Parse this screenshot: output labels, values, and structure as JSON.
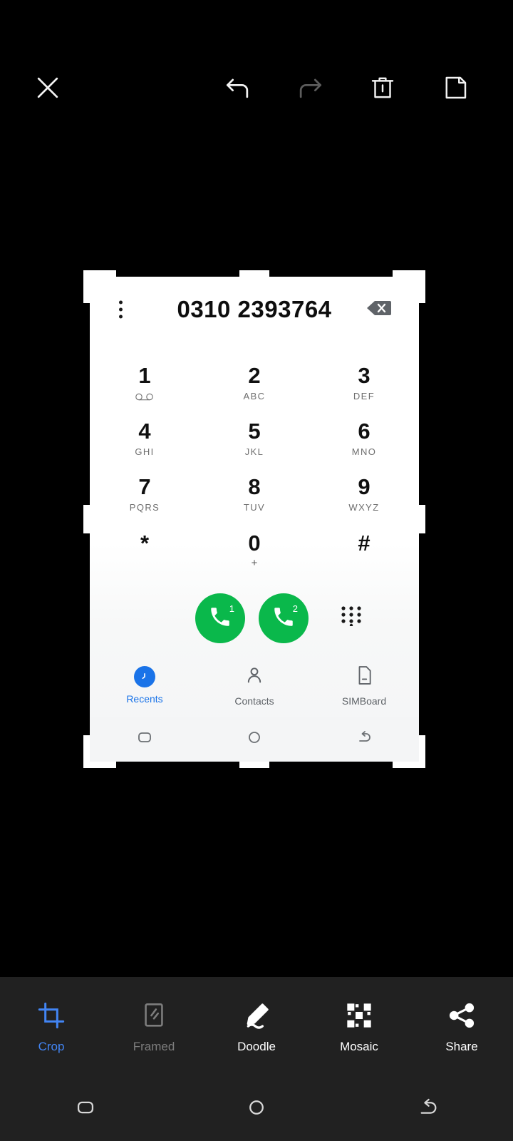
{
  "editor": {
    "top_toolbar": {
      "close_label": "Close",
      "undo_label": "Undo",
      "redo_label": "Redo",
      "delete_label": "Delete",
      "save_label": "Save",
      "icons": {
        "close": "close-icon",
        "undo": "undo-icon",
        "redo": "redo-icon",
        "delete": "trash-icon",
        "save": "save-icon"
      },
      "undo_state": "enabled",
      "redo_state": "disabled"
    },
    "bottom_toolbar": {
      "active_tool": "Crop",
      "tools": [
        {
          "label": "Crop",
          "icon": "crop-icon",
          "state": "active"
        },
        {
          "label": "Framed",
          "icon": "frame-icon",
          "state": "disabled"
        },
        {
          "label": "Doodle",
          "icon": "pen-icon",
          "state": "enabled"
        },
        {
          "label": "Mosaic",
          "icon": "mosaic-icon",
          "state": "enabled"
        },
        {
          "label": "Share",
          "icon": "share-icon",
          "state": "enabled"
        }
      ]
    },
    "crop_overlay": {
      "corner_handles": 4,
      "edge_handles": 4,
      "handle_color": "#ffffff"
    },
    "colors": {
      "background": "#000000",
      "toolbar": "#212121",
      "accent": "#4285f4",
      "disabled": "#7d7d7d"
    }
  },
  "photo": {
    "dialer": {
      "number_field": {
        "value": "0310 2393764",
        "overflow_menu": "more-options-icon",
        "backspace": "backspace-icon"
      },
      "keypad": [
        {
          "digit": "1",
          "letters": "",
          "sub_icon": "voicemail-icon"
        },
        {
          "digit": "2",
          "letters": "ABC",
          "sub_icon": ""
        },
        {
          "digit": "3",
          "letters": "DEF",
          "sub_icon": ""
        },
        {
          "digit": "4",
          "letters": "GHI",
          "sub_icon": ""
        },
        {
          "digit": "5",
          "letters": "JKL",
          "sub_icon": ""
        },
        {
          "digit": "6",
          "letters": "MNO",
          "sub_icon": ""
        },
        {
          "digit": "7",
          "letters": "PQRS",
          "sub_icon": ""
        },
        {
          "digit": "8",
          "letters": "TUV",
          "sub_icon": ""
        },
        {
          "digit": "9",
          "letters": "WXYZ",
          "sub_icon": ""
        },
        {
          "digit": "*",
          "letters": "",
          "sub_icon": ""
        },
        {
          "digit": "0",
          "letters": "+",
          "sub_icon": ""
        },
        {
          "digit": "#",
          "letters": "",
          "sub_icon": ""
        }
      ],
      "call_buttons": [
        {
          "sim": "1",
          "icon": "phone-icon",
          "color": "#0ab84b"
        },
        {
          "sim": "2",
          "icon": "phone-icon",
          "color": "#0ab84b"
        }
      ],
      "hide_keypad_icon": "keypad-dots-icon",
      "tabs": [
        {
          "label": "Recents",
          "icon": "clock-icon",
          "active": true
        },
        {
          "label": "Contacts",
          "icon": "person-icon",
          "active": false
        },
        {
          "label": "SIMBoard",
          "icon": "sim-card-icon",
          "active": false
        }
      ],
      "nav_bar": [
        {
          "icon": "recents-square-icon"
        },
        {
          "icon": "home-circle-icon"
        },
        {
          "icon": "back-arrow-icon"
        }
      ]
    }
  },
  "system_nav": [
    {
      "icon": "recents-square-icon"
    },
    {
      "icon": "home-circle-icon"
    },
    {
      "icon": "back-arrow-icon"
    }
  ]
}
